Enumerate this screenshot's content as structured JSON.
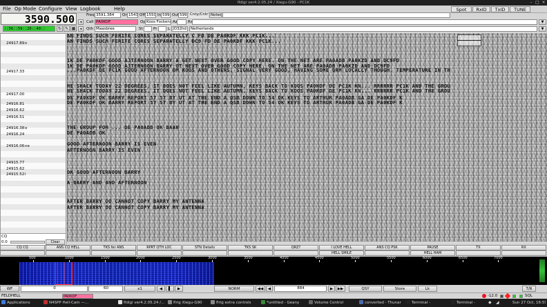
{
  "window": {
    "title": "fldigi ver4.2.05.24 / Xiegu-G90 - PC1K"
  },
  "menu": {
    "items": [
      "File",
      "Op Mode",
      "Configure",
      "View",
      "Logbook",
      "Help"
    ],
    "right_buttons": [
      "Spot",
      "RxID",
      "TxID",
      "TUNE"
    ]
  },
  "header": {
    "big_freq": "3590.500",
    "clock": "::56::59::20::40::",
    "labels": {
      "freq": "Freq",
      "on": "On",
      "off": "Off",
      "in": "In",
      "out": "Out",
      "cnty": "Cnty/Cntry",
      "notes": "Notes",
      "call": "Call",
      "op": "Op",
      "qth": "Qth",
      "az": "Az",
      "rx": "Rx",
      "st": "St",
      "pr": "Pr",
      "l": "L"
    },
    "freq": "3591.384",
    "on": "1543",
    "off": "1550",
    "in": "599",
    "out": "599",
    "call": "PA0KDF",
    "op": "Koos Fockens",
    "qth": "Maasbree",
    "locator": "JO32hd",
    "country": "Netherlands"
  },
  "freq_list": [
    {
      "freq": "24917.89",
      "call": "n"
    },
    {
      "freq": "24917.33",
      "call": ""
    },
    {
      "freq": "24917.00",
      "call": ""
    },
    {
      "freq": "24916.81",
      "call": ""
    },
    {
      "freq": "24916.62",
      "call": ""
    },
    {
      "freq": "24916.51",
      "call": ""
    },
    {
      "freq": "24916.38",
      "call": "o"
    },
    {
      "freq": "24916.24",
      "call": ""
    },
    {
      "freq": "24916.06",
      "call": "ne"
    },
    {
      "freq": "24915.77",
      "call": ""
    },
    {
      "freq": "24915.62",
      "call": ""
    },
    {
      "freq": "24915.52",
      "call": "i"
    }
  ],
  "rx_lines": [
    "AN FINDS SUCH FERITE CORES SEPARATELLY          C   FD  DE PA0KDF KKK       PC1K...",
    "AN FINDS SUCH FERITE CORES SEPARATELLY            DC9  FD  DE PA0KDF KKK       PC1K...",
    "1K  DE PA0KDF  GOOD AJTERNOON BARRY  A  GET NEXT OVER      GOOD COPY HERE.  ON THE NET ARE PA0ADB PA0KZD  AND DC9FD",
    "1K  DE PA0KDF  GOOD AJTERNOON BARRY   OT NEXT OVER      GOOD COPY HERE.  ON THE NET ARE PA0ADB PA0KZD  AND DC9FD",
    "...PA0KDF DE PC1K GOOD AFTERNOON OM KOOS AND OTHERS, SIGNAL VERY GOOD, HAVING SOME QRM LOCALLY THOUGH. TEMPERATURE IN TH",
    "HE SHACK TODAY 22 DEGREES, IT DOES NOT FEEL LIKE AUTUMN, KEYS BACK TO KOOS PA0KDF DE PC1K KN...  RRRRRR   PC1K  AND THE GROU",
    "HE SHACK TODAY 22 DEGREES, IT DOES NOT FEEL LIKE AUTUMN, KEYS BACK TO KOOS PA0KDF DE PC1K KN... RRRRRR   PC1K  AND THE GROU",
    " DE PA0KDF  OK BARRY   REPORT  57 57   BY UT  AT THE END A QSB  DOWN TO 54    OK KEYS TO ARTHUR PA0ADB  GA  DE PA0KDF K",
    " DE PA0KDF  OK BARRY   REPORT  57 57   BY UT  AT THE END A QSB  DOWN TO 54    OK KEYS TO ARTHUR PA0ADB  GA  DE PA0KDF K",
    "         THE GROUP FOR ...  DE PA0ADB OK BAAR    ",
    "                           DE PA0ADB OK                                                                              ",
    "                              GOOD AFTERNOON BARRY        IS EVEN                                                    ",
    "                                 AFTERNOON BARRY          IS EVEN                                                    ",
    "                                                                                                                     ",
    "                   OK          GOOD  AFTERNOON  BARRY                                                                ",
    "         A BARRY          AND          AND  AFTERNOON                                                                ",
    "         AFTER BARRY   OO                 CANNOT COPY BARRY         MY  ANTENNA                                      ",
    "         AFTER BARRY  OO             CANNOT COPY BARRY        MY  ANTENNA                                            "
  ],
  "tx": {
    "value_label": "CQ",
    "level": "0.0",
    "clear": "Clear"
  },
  "macros_row1": [
    "CQ CQ",
    "ANS CQ HELL",
    "TKS fer ANS",
    "RPRT QTH LOC",
    "STN Details",
    "TKS SK",
    "QRZ?",
    "I LOVE HELL",
    "ANS CQ PSK",
    "PAUSE",
    "TX",
    "RX"
  ],
  "macros_row2": [
    "",
    "",
    "",
    "",
    "",
    "",
    "",
    "HELL SMILE",
    "",
    "HELL HAM",
    "",
    ""
  ],
  "scale_ticks": [
    "500",
    "1000",
    "1500",
    "2000",
    "2500",
    "3000",
    "3500",
    "4000",
    "4500",
    "5000",
    "5500",
    "6000",
    "6500",
    "7000"
  ],
  "controls": {
    "wf": "WF",
    "wf_val": "0",
    "lvl_val": "60",
    "x1": "x1",
    "norm": "NORM",
    "freq_offset": "884",
    "qsy": "QSY",
    "store": "Store",
    "lk": "Lk",
    "tr": "T/R"
  },
  "status": {
    "mode": "FELDHELL",
    "mode_box": "PA0KDF",
    "afc": "-12.0",
    "sql": "SQL"
  },
  "taskbar": {
    "apps": "Applications",
    "items": [
      "N4SPP Hell-Cam —...",
      "fldigi ver4.2.05.24 /...",
      "flrig Xiegu-G90",
      "flrig extra controls",
      "*untitled - Geany",
      "Volume Control",
      "converted - Thunar",
      "Terminal -",
      "Terminal -"
    ],
    "clock": "Sun 27 Oct, 16:59"
  },
  "colors": {
    "freq_field": "#f0c9e6",
    "call_field": "#ff6fa0",
    "clock_field": "#32c832",
    "mode_box": "#ff6fa0",
    "waterfall_signal": "#1d2fd6",
    "cursor": "#ff2020"
  }
}
